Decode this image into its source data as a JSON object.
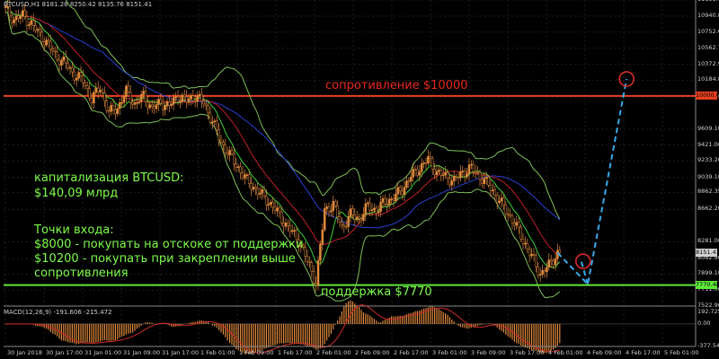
{
  "header": {
    "symbol_info": "BTCUSD,H1  8181.28 8250.42 8135.76 8151.41",
    "macd_label": "MACD(12,26,9) -191.606 -215.472"
  },
  "annotations": {
    "resistance": "сопротивление $10000",
    "support": "поддержка $7770",
    "cap_line1": "капитализация BTCUSD:",
    "cap_line2": "$140,09 млрд",
    "entry_title": "Точки входа:",
    "entry_1": "$8000 - покупать на отскоке от поддержки",
    "entry_2": "$10200 - покупать при закреплении выше",
    "entry_3": "сопротивления"
  },
  "chart_data": {
    "type": "candlestick",
    "symbol": "BTCUSD",
    "timeframe": "H1",
    "ylim": [
      7522.9,
      11131.0
    ],
    "y_ticks": [
      "11131.00",
      "10940.88",
      "10752.60",
      "10562.77",
      "10372.90",
      "10184.80",
      "9986.66",
      "9609.10",
      "9421.00",
      "9233.20",
      "9039.10",
      "8862.35",
      "8662.20",
      "8281.00",
      "8082.90",
      "7899.10",
      "7711.00",
      "7522.90"
    ],
    "current_price_tag": "8151.41",
    "resistance_tag": "10000.00",
    "support_tag": "7770.48",
    "x_labels": [
      "30 Jan 2018",
      "30 Jan 17:00",
      "31 Jan 01:00",
      "31 Jan 09:00",
      "31 Jan 17:00",
      "1 Feb 01:00",
      "1 Feb 09:00",
      "1 Feb 17:00",
      "2 Feb 01:00",
      "2 Feb 09:00",
      "2 Feb 17:00",
      "3 Feb 01:00",
      "3 Feb 09:00",
      "3 Feb 17:00",
      "4 Feb 01:00",
      "4 Feb 09:00",
      "4 Feb 17:00",
      "5 Feb 01:00"
    ],
    "resistance_level": 10000,
    "support_level": 7770,
    "price_path": [
      [
        0,
        11020
      ],
      [
        4,
        10900
      ],
      [
        8,
        10950
      ],
      [
        12,
        10850
      ],
      [
        16,
        10720
      ],
      [
        20,
        10600
      ],
      [
        24,
        10450
      ],
      [
        28,
        10380
      ],
      [
        32,
        10250
      ],
      [
        36,
        10180
      ],
      [
        40,
        9960
      ],
      [
        44,
        10100
      ],
      [
        48,
        9800
      ],
      [
        52,
        9860
      ],
      [
        56,
        10050
      ],
      [
        60,
        9900
      ],
      [
        64,
        10000
      ],
      [
        68,
        9850
      ],
      [
        72,
        9920
      ],
      [
        76,
        9880
      ],
      [
        80,
        10000
      ],
      [
        84,
        9940
      ],
      [
        88,
        10000
      ],
      [
        92,
        9920
      ],
      [
        96,
        9700
      ],
      [
        100,
        9450
      ],
      [
        104,
        9300
      ],
      [
        108,
        9150
      ],
      [
        112,
        9000
      ],
      [
        116,
        8900
      ],
      [
        120,
        8800
      ],
      [
        124,
        8700
      ],
      [
        128,
        8550
      ],
      [
        132,
        8420
      ],
      [
        136,
        8300
      ],
      [
        140,
        8050
      ],
      [
        144,
        7800
      ],
      [
        148,
        8650
      ],
      [
        152,
        8720
      ],
      [
        156,
        8450
      ],
      [
        160,
        8600
      ],
      [
        164,
        8550
      ],
      [
        168,
        8700
      ],
      [
        172,
        8650
      ],
      [
        176,
        8750
      ],
      [
        180,
        8800
      ],
      [
        184,
        8900
      ],
      [
        188,
        9050
      ],
      [
        192,
        9150
      ],
      [
        196,
        9250
      ],
      [
        200,
        9100
      ],
      [
        204,
        9050
      ],
      [
        208,
        9000
      ],
      [
        212,
        9100
      ],
      [
        216,
        9150
      ],
      [
        220,
        9050
      ],
      [
        224,
        8950
      ],
      [
        228,
        8800
      ],
      [
        232,
        8650
      ],
      [
        236,
        8500
      ],
      [
        240,
        8300
      ],
      [
        244,
        8100
      ],
      [
        248,
        7900
      ],
      [
        252,
        8000
      ],
      [
        256,
        8150
      ]
    ],
    "forecast_path": [
      [
        256,
        8150
      ],
      [
        270,
        7780
      ],
      [
        288,
        10200
      ]
    ],
    "target_up": [
      288,
      10200
    ],
    "target_bounce": [
      267,
      8050
    ],
    "macd_ylim": [
      -377.544,
      192.725
    ],
    "macd_ticks": [
      "192.725",
      "0.00",
      "-377.544"
    ]
  }
}
